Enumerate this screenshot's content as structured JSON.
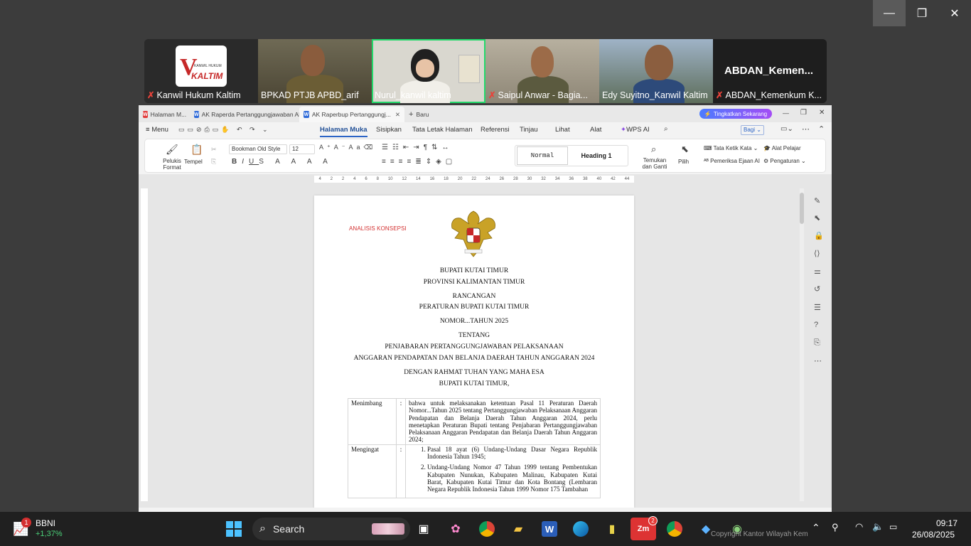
{
  "zoom": {
    "participants": [
      {
        "name": "Kanwil Hukum Kaltim",
        "muted": true
      },
      {
        "name": "BPKAD PTJB APBD_arif",
        "muted": false
      },
      {
        "name": "Nurul_kanwil kaltim",
        "muted": false
      },
      {
        "name": "Saipul Anwar - Bagia...",
        "muted": true
      },
      {
        "name": "Edy Suyitno_Kanwil Kaltim",
        "muted": false
      },
      {
        "name": "ABDAN_Kemenkum K...",
        "muted": true
      }
    ],
    "large_name": "ABDAN_Kemen...",
    "logo_text": "KALTIM",
    "logo_small": "KANWIL HUKUM"
  },
  "word": {
    "tabs": [
      {
        "label": "Halaman M...",
        "icon": "wps-icon"
      },
      {
        "label": "AK Raperda Pertanggungjawaban AF",
        "icon": "doc-icon"
      },
      {
        "label": "AK Raperbup Pertanggungj...",
        "icon": "doc-icon"
      }
    ],
    "new_tab": "Baru",
    "upgrade": "Tingkatkan Sekarang",
    "menu": "Menu",
    "ribbon_tabs": [
      "Halaman Muka",
      "Sisipkan",
      "Tata Letak Halaman",
      "Referensi",
      "Tinjau",
      "Lihat",
      "Alat",
      "WPS AI"
    ],
    "share": "Bagi",
    "ribbon": {
      "format_painter": "Pelukis Format",
      "paste": "Tempel",
      "font": "Bookman Old Style",
      "size": "12",
      "style_normal": "Normal",
      "style_h1": "Heading 1",
      "find_replace": "Temukan dan Ganti",
      "select": "Pilih",
      "typing": "Tata Ketik Kata",
      "study": "Alat Pelajar",
      "ai_check": "Pemeriksa Ejaan AI",
      "settings": "Pengaturan"
    },
    "ruler_ticks": [
      "4",
      "2",
      "2",
      "4",
      "6",
      "8",
      "10",
      "12",
      "14",
      "16",
      "18",
      "20",
      "22",
      "24",
      "26",
      "28",
      "30",
      "32",
      "34",
      "36",
      "38",
      "40",
      "42",
      "44"
    ]
  },
  "doc": {
    "header_label": "ANALISIS KONSEPSI",
    "lines": [
      "BUPATI KUTAI TIMUR",
      "PROVINSI KALIMANTAN TIMUR",
      "RANCANGAN",
      "PERATURAN BUPATI KUTAI TIMUR",
      "NOMOR...TAHUN 2025",
      "TENTANG",
      "PENJABARAN PERTANGGUNGJAWABAN PELAKSANAAN",
      "ANGGARAN PENDAPATAN DAN BELANJA DAERAH TAHUN ANGGARAN 2024",
      "DENGAN RAHMAT TUHAN YANG MAHA ESA",
      "BUPATI KUTAI TIMUR,"
    ],
    "menimbang_label": "Menimbang",
    "colon": ":",
    "menimbang_text": "bahwa untuk melaksanakan ketentuan Pasal 11 Peraturan Daerah Nomor...Tahun 2025 tentang Pertanggungjawaban Pelaksanaan Anggaran Pendapatan dan Belanja Daerah Tahun Anggaran 2024, perlu menetapkan Peraturan Bupati tentang Penjabaran Pertanggungjawaban Pelaksanaan Anggaran Pendapatan dan Belanja Daerah Tahun Anggaran 2024;",
    "mengingat_label": "Mengingat",
    "mengingat_items": [
      "Pasal 18 ayat (6) Undang-Undang Dasar Negara Republik Indonesia Tahun 1945;",
      "Undang-Undang Nomor 47 Tahun 1999 tentang Pembentukan Kabupaten Nunukan, Kabupaten Malinau, Kabupaten Kutai Barat, Kabupaten Kutai Timur dan Kota Bontang (Lembaran Negara Republik Indonesia Tahun 1999 Nomor 175 Tambahan"
    ]
  },
  "taskbar": {
    "stock_name": "BBNI",
    "stock_change": "+1,37%",
    "stock_badge": "1",
    "search": "Search",
    "zoom_badge": "2",
    "watermark": "Copyright Kantor Wilayah Kementerian Hukum...",
    "time": "09:17",
    "date": "26/08/2025"
  }
}
